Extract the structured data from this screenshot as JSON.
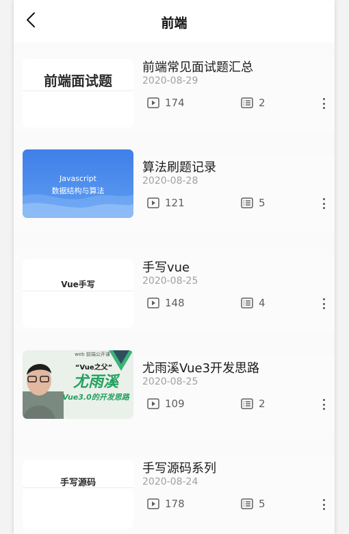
{
  "header": {
    "title": "前端"
  },
  "items": [
    {
      "title": "前端常见面试题汇总",
      "date": "2020-08-29",
      "views": "174",
      "episodes": "2",
      "thumb_text": "前端面试题"
    },
    {
      "title": "算法刷题记录",
      "date": "2020-08-28",
      "views": "121",
      "episodes": "5",
      "thumb_line1": "Javascript",
      "thumb_line2": "数据结构与算法"
    },
    {
      "title": "手写vue",
      "date": "2020-08-25",
      "views": "148",
      "episodes": "4",
      "thumb_text": "Vue手写"
    },
    {
      "title": "尤雨溪Vue3开发思路",
      "date": "2020-08-25",
      "views": "109",
      "episodes": "2",
      "thumb_top": "web 前端公开课",
      "thumb_quote": "“Vue之父”",
      "thumb_name": "尤雨溪",
      "thumb_sub": "Vue3.0的开发思路"
    },
    {
      "title": "手写源码系列",
      "date": "2020-08-24",
      "views": "178",
      "episodes": "5",
      "thumb_text": "手写源码"
    }
  ]
}
